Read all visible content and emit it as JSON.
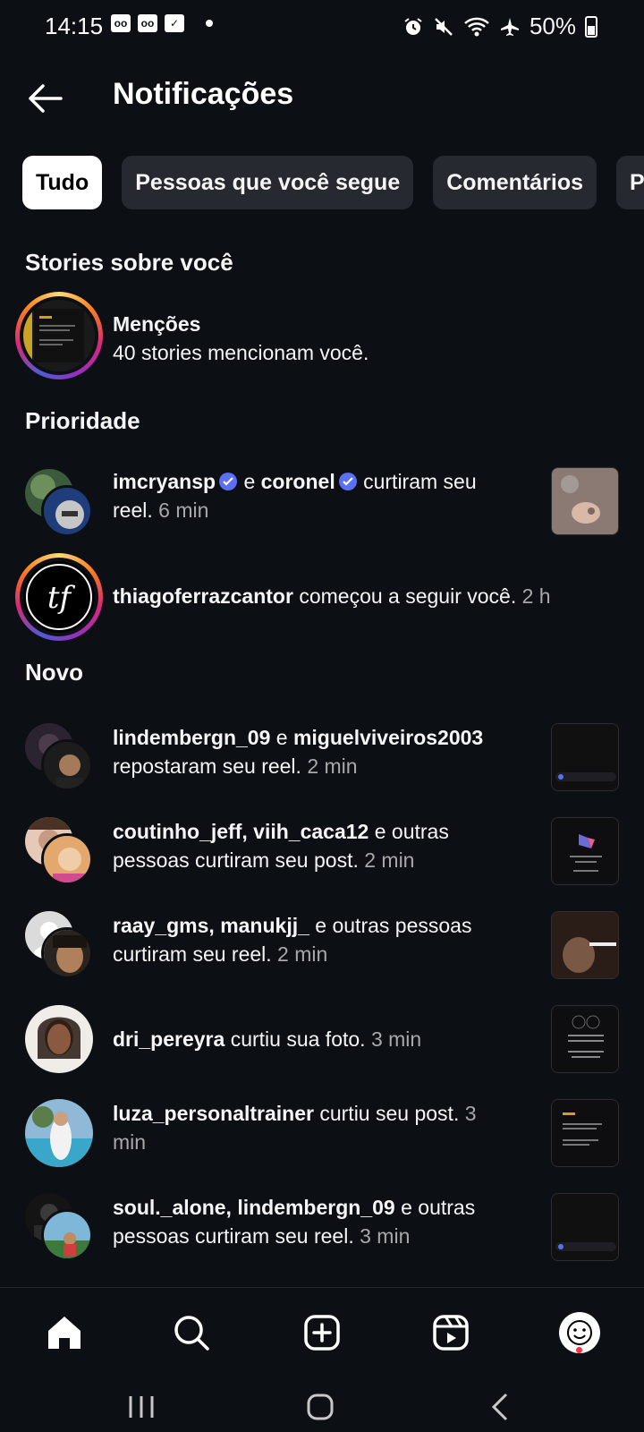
{
  "status_bar": {
    "time": "14:15",
    "battery": "50%"
  },
  "header": {
    "title": "Notificações"
  },
  "filters": [
    {
      "label": "Tudo",
      "active": true
    },
    {
      "label": "Pessoas que você segue",
      "active": false
    },
    {
      "label": "Comentários",
      "active": false
    },
    {
      "label": "Pr",
      "active": false
    }
  ],
  "sections": {
    "stories": "Stories sobre você",
    "priority": "Prioridade",
    "new": "Novo"
  },
  "mentions": {
    "title": "Menções",
    "subtitle": "40 stories mencionam você."
  },
  "priority": [
    {
      "user1": "imcryansp",
      "conj": " e ",
      "user2": "coronel",
      "action": " curtiram seu reel.",
      "time": " 6 min"
    },
    {
      "user1": "thiagoferrazcantor",
      "action": " começou a seguir você.",
      "time": " 2 h"
    }
  ],
  "new_items": [
    {
      "users": "lindembergn_09",
      "conj": " e ",
      "users2": "miguelviveiros2003",
      "action": " repostaram seu reel.",
      "time": " 2 min"
    },
    {
      "users": "coutinho_jeff, viih_caca12",
      "action": " e outras pessoas curtiram seu post.",
      "time": " 2 min"
    },
    {
      "users": "raay_gms, manukjj_",
      "action": " e outras pessoas curtiram seu reel.",
      "time": " 2 min"
    },
    {
      "users": "dri_pereyra",
      "action": " curtiu sua foto.",
      "time": " 3 min"
    },
    {
      "users": "luza_personaltrainer",
      "action": " curtiu seu post.",
      "time": " 3 min"
    },
    {
      "users": "soul._alone, lindembergn_09",
      "action": " e outras pessoas curtiram seu reel.",
      "time": " 3 min"
    }
  ],
  "colors": {
    "background": "#0c1014",
    "chip": "#262a30",
    "verified": "#5b6ff7",
    "muted": "#a8a8a8",
    "badge": "#ff3040"
  },
  "icons": {
    "back": "arrow-left-icon",
    "tabs": [
      "home-icon",
      "search-icon",
      "create-icon",
      "reels-icon",
      "profile-avatar"
    ],
    "system": [
      "recents-icon",
      "home-circle-icon",
      "back-chevron-icon"
    ]
  }
}
